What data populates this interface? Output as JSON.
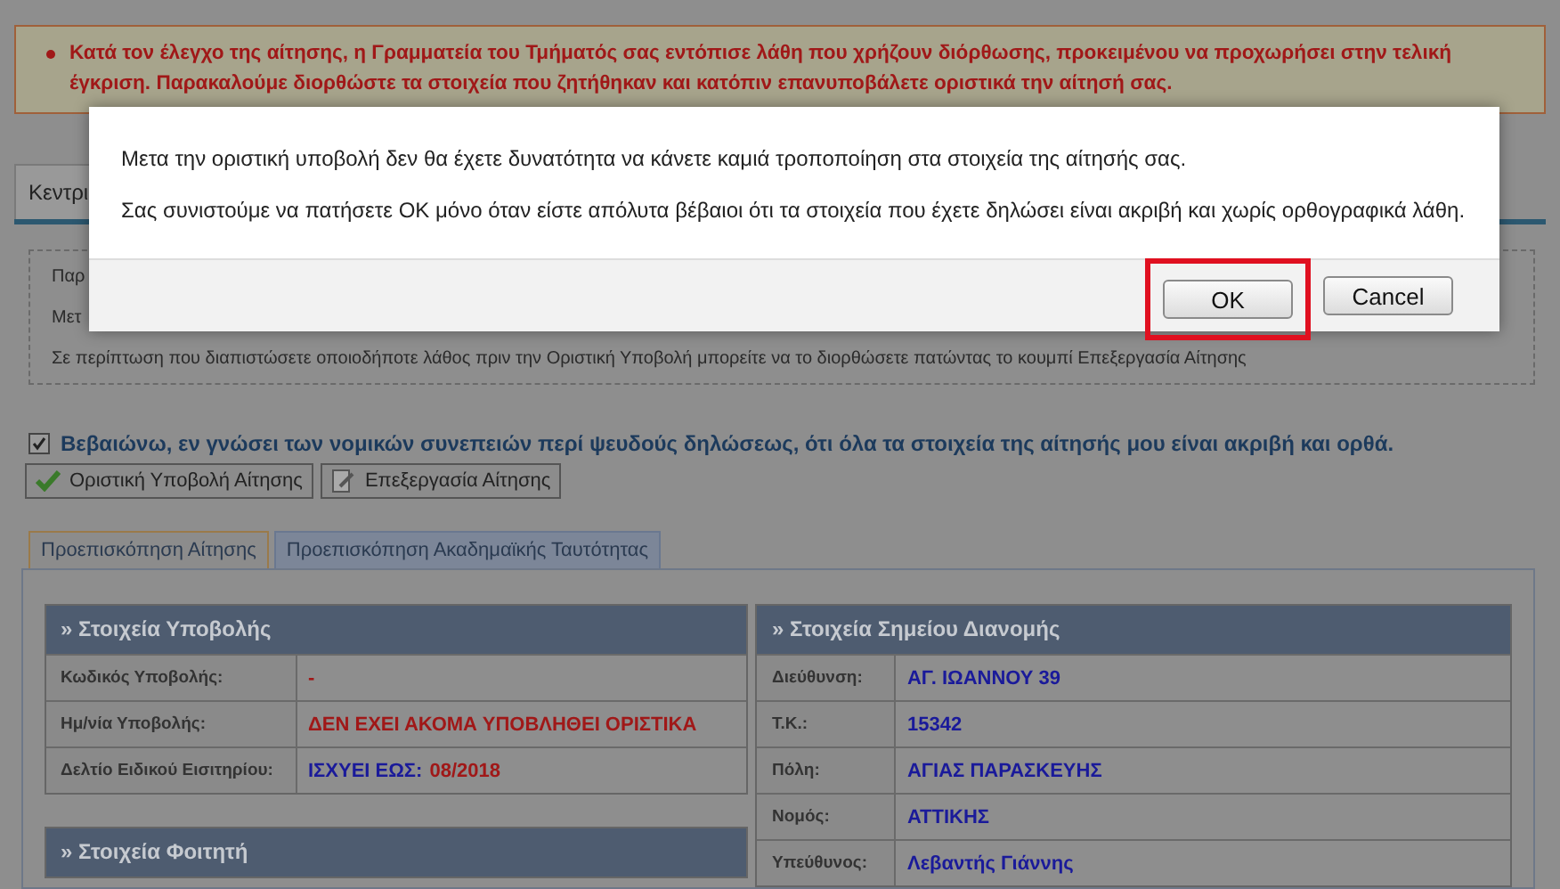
{
  "alert": {
    "text": "Κατά τον έλεγχο της αίτησης, η Γραμματεία του Τμήματός σας εντόπισε λάθη που χρήζουν διόρθωσης, προκειμένου να προχωρήσει στην τελική έγκριση. Παρακαλούμε διορθώστε τα στοιχεία που ζητήθηκαν και κατόπιν επανυποβάλετε οριστικά την αίτησή σας."
  },
  "top_tabs": [
    {
      "label": "Κεντρι",
      "selected": true
    }
  ],
  "notice_lines": [
    "Παρ",
    "Μετ",
    "Σε περίπτωση που διαπιστώσετε οποιοδήποτε λάθος πριν την Οριστική Υποβολή μπορείτε να το διορθώσετε πατώντας το κουμπί Επεξεργασία Αίτησης"
  ],
  "declaration": {
    "checked": true,
    "text": "Βεβαιώνω, εν γνώσει των νομικών συνεπειών περί ψευδούς δηλώσεως, ότι όλα τα στοιχεία της αίτησής μου είναι ακριβή και ορθά."
  },
  "actions": [
    {
      "label": "Οριστική Υποβολή Αίτησης",
      "kind": "submit"
    },
    {
      "label": "Επεξεργασία Αίτησης",
      "kind": "edit"
    }
  ],
  "preview_tabs": [
    {
      "label": "Προεπισκόπηση Αίτησης",
      "selected": true
    },
    {
      "label": "Προεπισκόπηση Ακαδημαϊκής Ταυτότητας",
      "selected": false
    }
  ],
  "left_sections": [
    {
      "title": "» Στοιχεία Υποβολής",
      "rows": [
        {
          "label": "Κωδικός Υποβολής:",
          "value": [
            {
              "text": "-",
              "color": "#a01818"
            }
          ]
        },
        {
          "label": "Ημ/νία Υποβολής:",
          "value": [
            {
              "text": "ΔΕΝ ΕΧΕΙ ΑΚΟΜΑ ΥΠΟΒΛΗΘΕΙ ΟΡΙΣΤΙΚΑ",
              "color": "#a01818"
            }
          ]
        },
        {
          "label": "Δελτίο Ειδικού Εισιτηρίου:",
          "value": [
            {
              "text": "ΙΣΧΥΕΙ ΕΩΣ:",
              "color": "#1a1a9a"
            },
            {
              "text": "08/2018",
              "color": "#a01818"
            }
          ]
        }
      ]
    },
    {
      "title": "» Στοιχεία Φοιτητή"
    }
  ],
  "right_sections": [
    {
      "title": "» Στοιχεία Σημείου Διανομής",
      "rows": [
        {
          "label": "Διεύθυνση:",
          "value": [
            {
              "text": "ΑΓ. ΙΩΑΝΝΟΥ 39",
              "color": "#1a1a9a"
            }
          ]
        },
        {
          "label": "Τ.Κ.:",
          "value": [
            {
              "text": "15342",
              "color": "#1a1a9a"
            }
          ]
        },
        {
          "label": "Πόλη:",
          "value": [
            {
              "text": "ΑΓΙΑΣ ΠΑΡΑΣΚΕΥΗΣ",
              "color": "#1a1a9a"
            }
          ]
        },
        {
          "label": "Νομός:",
          "value": [
            {
              "text": "ΑΤΤΙΚΗΣ",
              "color": "#1a1a9a"
            }
          ]
        },
        {
          "label": "Υπεύθυνος:",
          "value": [
            {
              "text": "Λεβαντής Γιάννης",
              "color": "#1a1a9a"
            }
          ]
        }
      ]
    }
  ],
  "dialog": {
    "messages": [
      "Μετα την οριστική υποβολή δεν θα έχετε δυνατότητα να κάνετε καμιά τροποποίηση στα στοιχεία της αίτησής σας.",
      "Σας συνιστούμε να πατήσετε ΟΚ μόνο όταν είστε απόλυτα βέβαιοι ότι τα στοιχεία που έχετε δηλώσει είναι ακριβή και χωρίς ορθογραφικά λάθη."
    ],
    "buttons": [
      {
        "label": "OK",
        "highlighted": true
      },
      {
        "label": "Cancel",
        "highlighted": false
      }
    ]
  }
}
